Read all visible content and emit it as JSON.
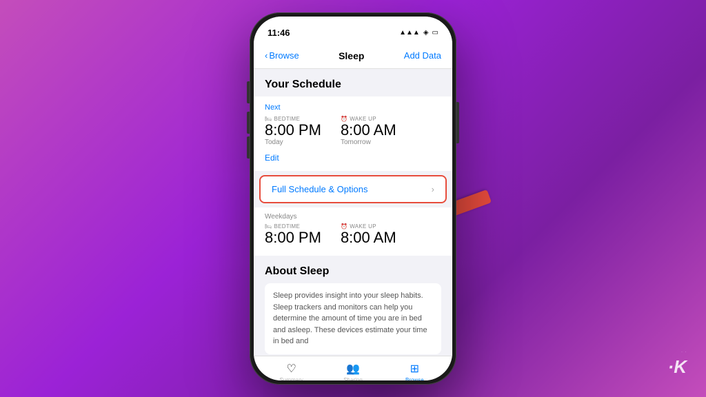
{
  "background": {
    "gradient_start": "#c44dbb",
    "gradient_end": "#7b1fa2"
  },
  "brand": {
    "logo": "·K",
    "dots": [
      "·",
      "·"
    ]
  },
  "phone": {
    "status_bar": {
      "time": "11:46",
      "icons": [
        "signal",
        "wifi",
        "battery"
      ]
    },
    "nav": {
      "back_label": "Browse",
      "title": "Sleep",
      "action_label": "Add Data"
    },
    "content": {
      "schedule_section": {
        "title": "Your Schedule",
        "next_label": "Next",
        "bedtime_label": "BEDTIME",
        "wakeup_label": "WAKE UP",
        "bedtime_icon": "🛏",
        "wakeup_icon": "⏰",
        "bedtime_time": "8:00 PM",
        "wakeup_time": "8:00 AM",
        "bedtime_day": "Today",
        "wakeup_day": "Tomorrow",
        "edit_label": "Edit"
      },
      "full_schedule_btn": {
        "label": "Full Schedule & Options",
        "chevron": "›"
      },
      "weekdays_card": {
        "label": "Weekdays",
        "bedtime_label": "BEDTIME",
        "wakeup_label": "WAKE UP",
        "bedtime_icon": "🛏",
        "wakeup_icon": "⏰",
        "bedtime_time": "8:00 PM",
        "wakeup_time": "8:00 AM"
      },
      "about_section": {
        "title": "About Sleep",
        "body": "Sleep provides insight into your sleep habits. Sleep trackers and monitors can help you determine the amount of time you are in bed and asleep. These devices estimate your time in bed and"
      }
    },
    "tab_bar": {
      "tabs": [
        {
          "icon": "♡",
          "label": "Summary",
          "active": false
        },
        {
          "icon": "👥",
          "label": "Sharing",
          "active": false
        },
        {
          "icon": "⊞",
          "label": "Browse",
          "active": true
        }
      ]
    }
  }
}
